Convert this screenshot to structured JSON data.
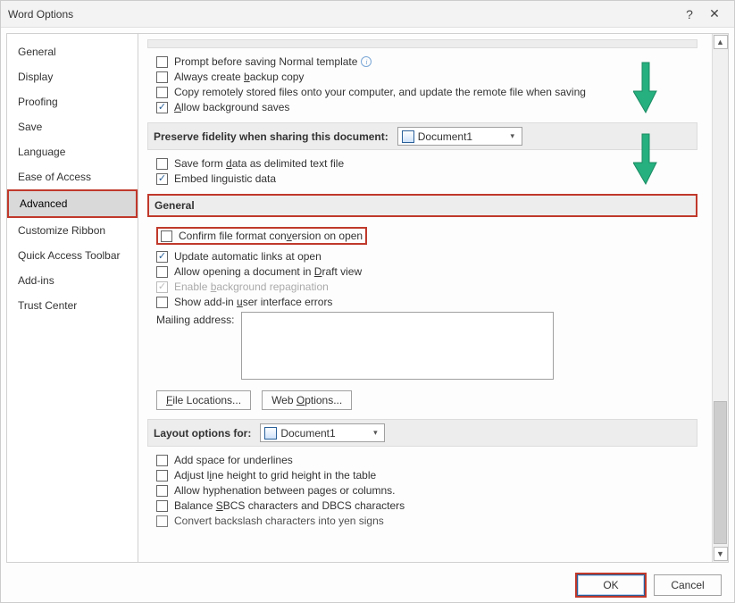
{
  "title": "Word Options",
  "sidebar": {
    "items": [
      {
        "label": "General"
      },
      {
        "label": "Display"
      },
      {
        "label": "Proofing"
      },
      {
        "label": "Save"
      },
      {
        "label": "Language"
      },
      {
        "label": "Ease of Access"
      },
      {
        "label": "Advanced",
        "selected": true
      },
      {
        "label": "Customize Ribbon"
      },
      {
        "label": "Quick Access Toolbar"
      },
      {
        "label": "Add-ins"
      },
      {
        "label": "Trust Center"
      }
    ]
  },
  "save_section": {
    "prompt_normal": "Prompt before saving Normal template",
    "always_backup_pre": "Always create ",
    "always_backup_ul": "b",
    "always_backup_post": "ackup copy",
    "copy_remote": "Copy remotely stored files onto your computer, and update the remote file when saving",
    "allow_bg_pre": "",
    "allow_bg_ul": "A",
    "allow_bg_post": "llow background saves"
  },
  "preserve": {
    "heading": "Preserve fidelity when sharing this document:",
    "doc_name": "Document1",
    "save_form_pre": "Save form ",
    "save_form_ul": "d",
    "save_form_post": "ata as delimited text file",
    "embed_ling": "Embed linguistic data"
  },
  "general": {
    "heading": "General",
    "confirm_conv_pre": "Confirm file format con",
    "confirm_conv_ul": "v",
    "confirm_conv_post": "ersion on open",
    "update_links": "Update automatic links at open",
    "draft_pre": "Allow opening a document in ",
    "draft_ul": "D",
    "draft_post": "raft view",
    "bg_repag_pre": "Enable ",
    "bg_repag_ul": "b",
    "bg_repag_post": "ackground repagination",
    "addin_err_pre": "Show add-in ",
    "addin_err_ul": "u",
    "addin_err_post": "ser interface errors",
    "mailing_pre": "Mailing a",
    "mailing_ul": "d",
    "mailing_post": "dress:",
    "file_loc_ul": "F",
    "file_loc_post": "ile Locations...",
    "web_opt_pre": "Web ",
    "web_opt_ul": "O",
    "web_opt_post": "ptions..."
  },
  "layout": {
    "heading": "Layout options for:",
    "doc_name": "Document1",
    "opts": {
      "add_space": "Add space for underlines",
      "adjust_line_pre": "Adjust l",
      "adjust_line_ul": "i",
      "adjust_line_post": "ne height to grid height in the table",
      "allow_hyph": "Allow hyphenation between pages or columns.",
      "balance_pre": "Balance ",
      "balance_ul": "S",
      "balance_post": "BCS characters and DBCS characters",
      "convert_yen": "Convert backslash characters into yen signs"
    }
  },
  "footer": {
    "ok": "OK",
    "cancel": "Cancel"
  }
}
